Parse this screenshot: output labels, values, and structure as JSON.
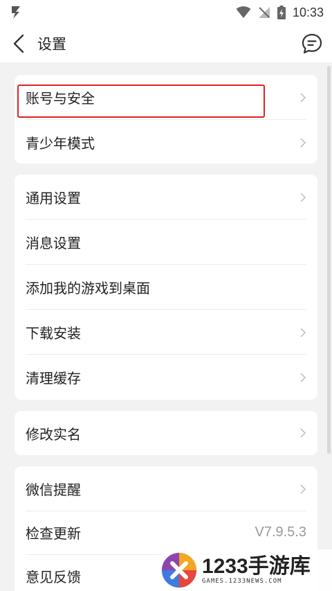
{
  "status_bar": {
    "time": "10:33",
    "icons": [
      "app-notification-icon",
      "wifi-icon",
      "no-signal-icon",
      "battery-charging-icon"
    ]
  },
  "header": {
    "title": "设置",
    "back_icon": "chevron-left-icon",
    "feedback_icon": "chat-bubble-icon"
  },
  "groups": [
    {
      "items": [
        {
          "label": "账号与安全",
          "chevron": true,
          "highlighted": true
        },
        {
          "label": "青少年模式",
          "chevron": true
        }
      ]
    },
    {
      "items": [
        {
          "label": "通用设置",
          "chevron": true
        },
        {
          "label": "消息设置",
          "chevron": false
        },
        {
          "label": "添加我的游戏到桌面",
          "chevron": false
        },
        {
          "label": "下载安装",
          "chevron": true
        },
        {
          "label": "清理缓存",
          "chevron": true
        }
      ]
    },
    {
      "items": [
        {
          "label": "修改实名",
          "chevron": true
        }
      ]
    },
    {
      "items": [
        {
          "label": "微信提醒",
          "chevron": true
        },
        {
          "label": "检查更新",
          "value": "V7.9.5.3"
        },
        {
          "label": "意见反馈",
          "chevron": false
        }
      ]
    }
  ],
  "watermark": {
    "title": "1233手游库",
    "subtitle": "GAMES.1233NEWS.COM"
  },
  "colors": {
    "highlight": "#e02020",
    "background": "#f2f2f2",
    "card": "#ffffff"
  }
}
